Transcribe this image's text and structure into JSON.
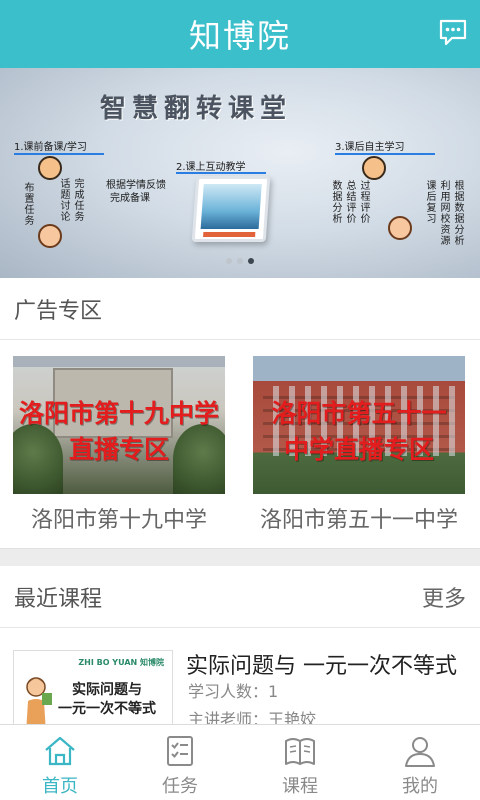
{
  "header": {
    "title": "知博院",
    "message_icon": "chat-bubble-icon"
  },
  "banner": {
    "title": "智慧翻转课堂",
    "step1": "1.课前备课/学习",
    "step2": "2.课上互动教学",
    "step3": "3.课后自主学习",
    "mid_note": [
      "根据学情反馈",
      "完成备课"
    ],
    "v_assign": "布置任务",
    "v_discuss": "话题讨论",
    "v_complete": "完成任务",
    "v_data": "数据分析",
    "v_summary": "总结评价",
    "v_process": "过程评价",
    "v_review": "课后复习",
    "v_net": "利用网校资源",
    "v_data2": "根据数据分析",
    "slide_count": 3,
    "active_slide": 3
  },
  "ads_section": {
    "title": "广告专区",
    "items": [
      {
        "overlay_lines": [
          "洛阳市第十九中学",
          "直播专区"
        ],
        "caption": "洛阳市第十九中学"
      },
      {
        "overlay_lines": [
          "洛阳市第五十一",
          "中学直播专区"
        ],
        "caption": "洛阳市第五十一中学"
      }
    ]
  },
  "recent_section": {
    "title": "最近课程",
    "more_label": "更多"
  },
  "course": {
    "title": "实际问题与 一元一次不等式",
    "learners": "学习人数：1",
    "teacher": "主讲老师：王艳姣",
    "thumb_logo": "ZHI BO YUAN 知博院",
    "thumb_lines": [
      "实际问题与",
      "一元一次不等式"
    ]
  },
  "tabbar": {
    "tabs": [
      {
        "label": "首页",
        "icon": "home-icon",
        "active": true
      },
      {
        "label": "任务",
        "icon": "checklist-icon",
        "active": false
      },
      {
        "label": "课程",
        "icon": "book-icon",
        "active": false
      },
      {
        "label": "我的",
        "icon": "user-icon",
        "active": false
      }
    ]
  },
  "colors": {
    "accent": "#3bbfcb",
    "ad_overlay_text": "#e31d1d"
  }
}
